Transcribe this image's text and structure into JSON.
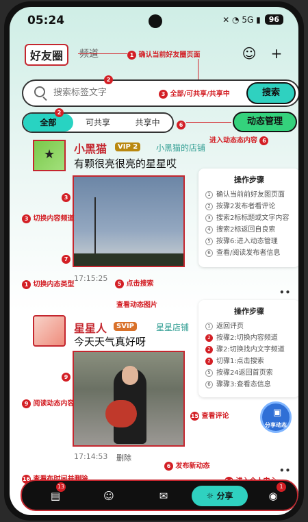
{
  "status": {
    "time": "05:24",
    "icons": "✕ ◔ 5G ▮",
    "battery": "96"
  },
  "topnav": {
    "logo": "好友圈",
    "channel": "频道",
    "user_icon": "user-icon",
    "add_icon": "plus-icon"
  },
  "search": {
    "placeholder": "搜索标签文字",
    "button": "搜索"
  },
  "filters": {
    "tabs": [
      "全部",
      "可共享",
      "共享中"
    ],
    "manage": "动态管理"
  },
  "annotations": {
    "a1": "确认当前好友圈页面",
    "a2": "全部/可共享/共享中",
    "a3": "切换内容频道",
    "a4": "进入动态态内容",
    "a5": "点击搜索",
    "a6": "切换内态类型",
    "a7": "查看动态图片",
    "a8": "阅读动态内容",
    "a9": "查看评论",
    "a10": "发布新动态",
    "a11": "查看布时间并删除",
    "a12": "进入个人中心"
  },
  "post1": {
    "username": "小黑猫",
    "vip": "VIP 2",
    "store": "小黑猫的店铺",
    "title": "有颗很亮很亮的星星哎",
    "time": "17:15:25"
  },
  "steps1": {
    "title": "操作步骤",
    "items": [
      "确认当前前好友图页面",
      "按骤2发布者看评论",
      "搜索2标标题或文字内容",
      "搜索2标返回自良索",
      "按骤6:进入动态管理",
      "查看/阅读发布者信息"
    ]
  },
  "post2": {
    "username": "星星人",
    "vip": "SVIP",
    "store": "星星店铺",
    "title": "今天天气真好呀",
    "time": "17:14:53",
    "delete": "删除"
  },
  "steps2": {
    "title": "操作步骤",
    "items": [
      "返回评页",
      "按骤2:切换内容频道",
      "骤2:切换找内文字频道",
      "切骤1:点击搜索",
      "按骤24返回首页索",
      "骤骤3:查看态信息"
    ]
  },
  "fab": {
    "label": "分享动态"
  },
  "bottomnav": {
    "share": "分享",
    "badge_left": "13",
    "badge_right": "1"
  }
}
